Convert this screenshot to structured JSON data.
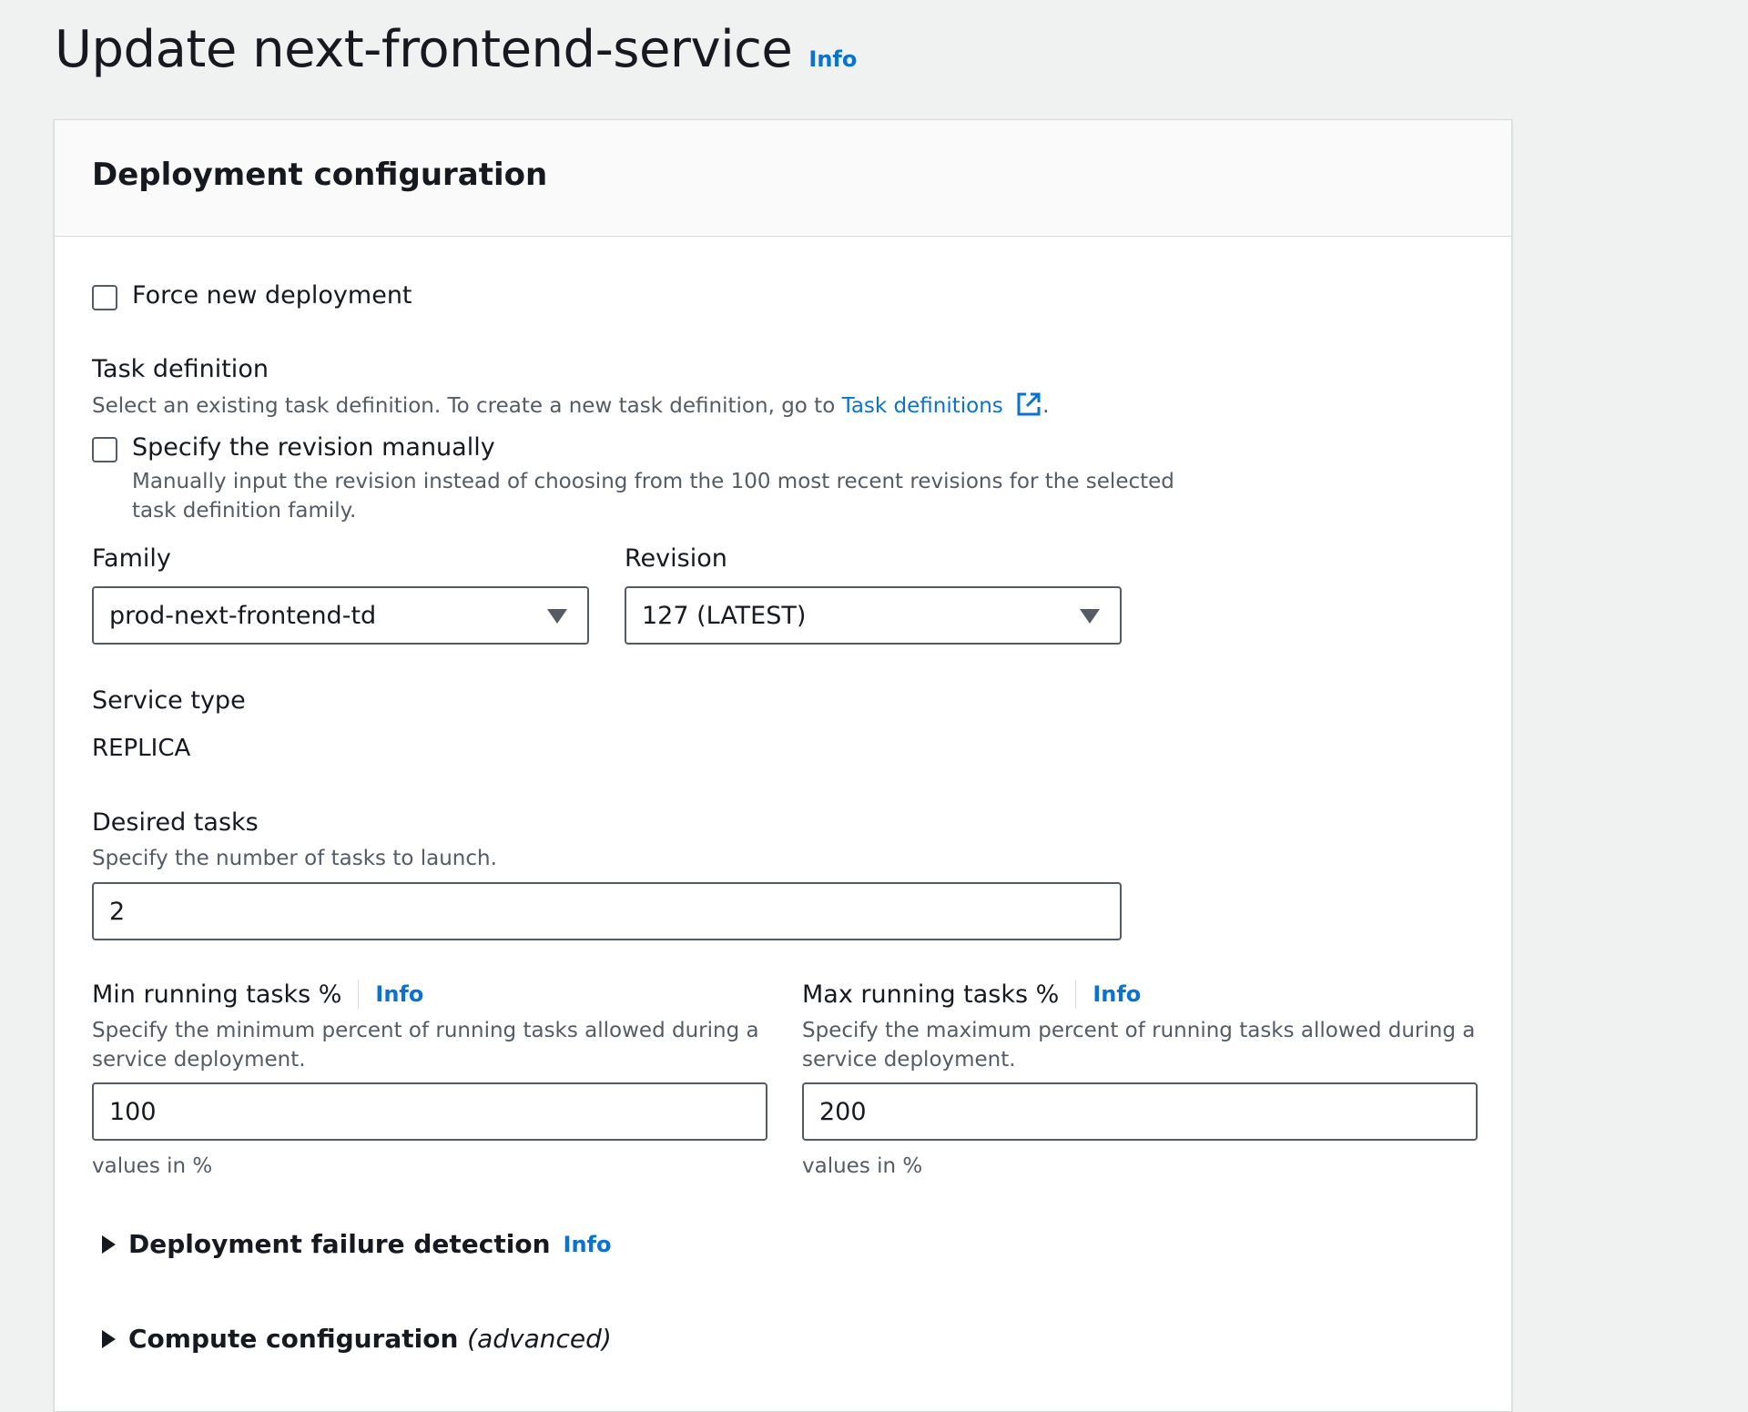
{
  "page": {
    "title": "Update next-frontend-service",
    "info_label": "Info"
  },
  "panel": {
    "title": "Deployment configuration"
  },
  "force_deployment": {
    "label": "Force new deployment",
    "checked": false
  },
  "task_definition": {
    "label": "Task definition",
    "description_prefix": "Select an existing task definition. To create a new task definition, go to",
    "link_text": "Task definitions",
    "description_suffix": ".",
    "manual_revision": {
      "label": "Specify the revision manually",
      "checked": false,
      "description_line1": "Manually input the revision instead of choosing from the 100 most recent revisions for the selected",
      "description_line2": "task definition family."
    },
    "family": {
      "label": "Family",
      "value": "prod-next-frontend-td"
    },
    "revision": {
      "label": "Revision",
      "value": "127 (LATEST)"
    }
  },
  "service_type": {
    "label": "Service type",
    "value": "REPLICA"
  },
  "desired_tasks": {
    "label": "Desired tasks",
    "description": "Specify the number of tasks to launch.",
    "value": "2"
  },
  "min_running": {
    "label": "Min running tasks %",
    "info_label": "Info",
    "description_line1": "Specify the minimum percent of running tasks allowed during a",
    "description_line2": "service deployment.",
    "value": "100",
    "hint": "values in %"
  },
  "max_running": {
    "label": "Max running tasks %",
    "info_label": "Info",
    "description_line1": "Specify the maximum percent of running tasks allowed during a",
    "description_line2": "service deployment.",
    "value": "200",
    "hint": "values in %"
  },
  "sections": {
    "failure_detection": {
      "title": "Deployment failure detection",
      "info_label": "Info"
    },
    "compute": {
      "title": "Compute configuration",
      "title_suffix": "(advanced)"
    }
  },
  "icons": {
    "external_link": "external-link-icon",
    "caret_down": "caret-down-icon",
    "caret_right": "caret-right-icon"
  },
  "colors": {
    "accent_link": "#0972d3",
    "text": "#16191f",
    "muted": "#545b64",
    "background": "#f0f1f1",
    "border": "#d5dbdb"
  }
}
